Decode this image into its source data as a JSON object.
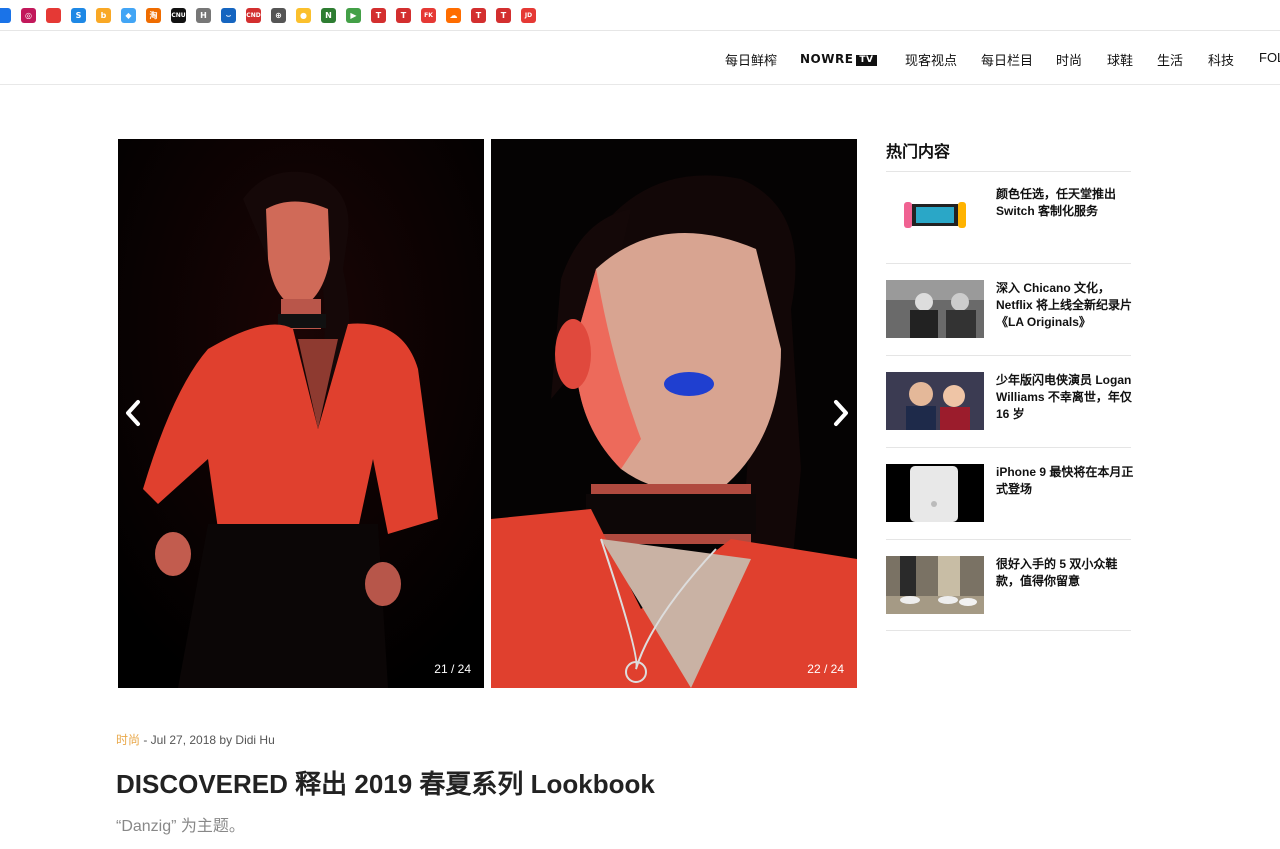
{
  "bookmarks": [
    {
      "icon": "blue-app-icon",
      "color": "#1a73e8",
      "glyph": ""
    },
    {
      "icon": "pink-swirl-icon",
      "color": "#c2185b",
      "glyph": "◎"
    },
    {
      "icon": "red-yellow-icon",
      "color": "#e53935",
      "glyph": ""
    },
    {
      "icon": "blue-s-icon",
      "color": "#1e88e5",
      "glyph": "S"
    },
    {
      "icon": "orange-b-icon",
      "color": "#f9a825",
      "glyph": "b"
    },
    {
      "icon": "diamond-icon",
      "color": "#42a5f5",
      "glyph": "◆"
    },
    {
      "icon": "kanji-icon",
      "color": "#ef6c00",
      "glyph": "淘"
    },
    {
      "icon": "cnu-icon",
      "color": "#111111",
      "glyph": ""
    },
    {
      "icon": "h-script-icon",
      "color": "#777777",
      "glyph": "H"
    },
    {
      "icon": "swoosh-icon",
      "color": "#1565c0",
      "glyph": "⌣"
    },
    {
      "icon": "cnd-icon",
      "color": "#d32f2f",
      "glyph": ""
    },
    {
      "icon": "globe-icon",
      "color": "#555555",
      "glyph": "⊕"
    },
    {
      "icon": "cat-icon",
      "color": "#fbc02d",
      "glyph": "●"
    },
    {
      "icon": "green-n-icon",
      "color": "#2e7d32",
      "glyph": "N"
    },
    {
      "icon": "play-store-icon",
      "color": "#43a047",
      "glyph": "▶"
    },
    {
      "icon": "red-t-icon",
      "color": "#d32f2f",
      "glyph": "T"
    },
    {
      "icon": "red-t-icon-2",
      "color": "#d32f2f",
      "glyph": "T"
    },
    {
      "icon": "fk-icon",
      "color": "#e53935",
      "glyph": ""
    },
    {
      "icon": "cloud-icon",
      "color": "#ff6d00",
      "glyph": "☁"
    },
    {
      "icon": "red-t-icon-3",
      "color": "#d32f2f",
      "glyph": "T"
    },
    {
      "icon": "red-t-icon-4",
      "color": "#d32f2f",
      "glyph": "T"
    },
    {
      "icon": "jd-icon",
      "color": "#e53935",
      "glyph": ""
    }
  ],
  "nav": {
    "items": [
      "每日鲜榨",
      "现客视点",
      "每日栏目",
      "时尚",
      "球鞋",
      "生活",
      "科技",
      "FOL"
    ],
    "brand": "NOWRE",
    "brand_tv": "TV"
  },
  "gallery": {
    "slide1_counter": "21 / 24",
    "slide2_counter": "22 / 24"
  },
  "sidebar": {
    "title": "热门内容",
    "items": [
      {
        "title": "颜色任选，任天堂推出 Switch 客制化服务"
      },
      {
        "title": "深入 Chicano 文化，Netflix 将上线全新纪录片《LA Originals》"
      },
      {
        "title": "少年版闪电侠演员 Logan Williams 不幸离世，年仅 16 岁"
      },
      {
        "title": "iPhone 9 最快将在本月正式登场"
      },
      {
        "title": "很好入手的 5 双小众鞋款，值得你留意"
      }
    ]
  },
  "article": {
    "category": "时尚",
    "meta_rest": " - Jul 27, 2018 by Didi Hu",
    "title": "DISCOVERED 释出 2019 春夏系列 Lookbook",
    "subtitle": "“Danzig” 为主题。"
  },
  "colors": {
    "accent": "#e9a84a",
    "shirt_red": "#e0402e"
  }
}
